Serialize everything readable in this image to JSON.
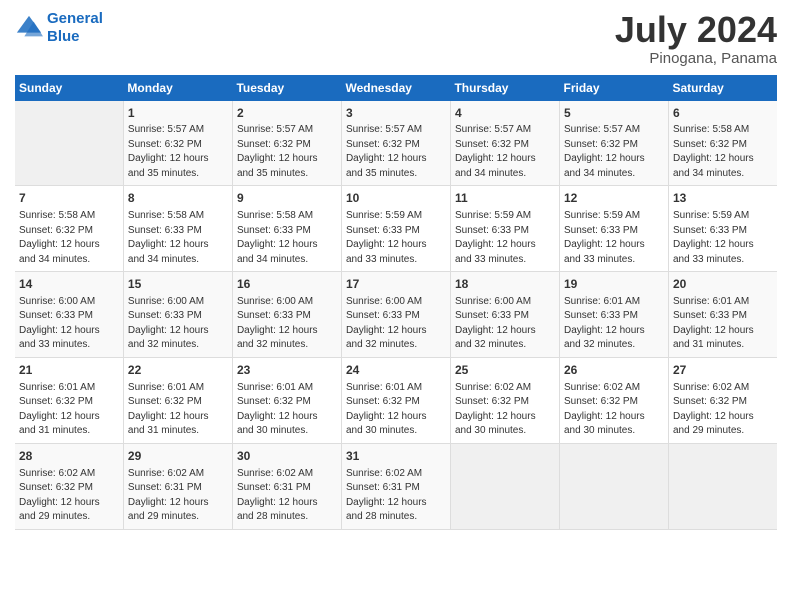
{
  "header": {
    "logo_line1": "General",
    "logo_line2": "Blue",
    "title": "July 2024",
    "subtitle": "Pinogana, Panama"
  },
  "days_of_week": [
    "Sunday",
    "Monday",
    "Tuesday",
    "Wednesday",
    "Thursday",
    "Friday",
    "Saturday"
  ],
  "weeks": [
    [
      {
        "day": "",
        "content": ""
      },
      {
        "day": "1",
        "content": "Sunrise: 5:57 AM\nSunset: 6:32 PM\nDaylight: 12 hours\nand 35 minutes."
      },
      {
        "day": "2",
        "content": "Sunrise: 5:57 AM\nSunset: 6:32 PM\nDaylight: 12 hours\nand 35 minutes."
      },
      {
        "day": "3",
        "content": "Sunrise: 5:57 AM\nSunset: 6:32 PM\nDaylight: 12 hours\nand 35 minutes."
      },
      {
        "day": "4",
        "content": "Sunrise: 5:57 AM\nSunset: 6:32 PM\nDaylight: 12 hours\nand 34 minutes."
      },
      {
        "day": "5",
        "content": "Sunrise: 5:57 AM\nSunset: 6:32 PM\nDaylight: 12 hours\nand 34 minutes."
      },
      {
        "day": "6",
        "content": "Sunrise: 5:58 AM\nSunset: 6:32 PM\nDaylight: 12 hours\nand 34 minutes."
      }
    ],
    [
      {
        "day": "7",
        "content": "Sunrise: 5:58 AM\nSunset: 6:32 PM\nDaylight: 12 hours\nand 34 minutes."
      },
      {
        "day": "8",
        "content": "Sunrise: 5:58 AM\nSunset: 6:33 PM\nDaylight: 12 hours\nand 34 minutes."
      },
      {
        "day": "9",
        "content": "Sunrise: 5:58 AM\nSunset: 6:33 PM\nDaylight: 12 hours\nand 34 minutes."
      },
      {
        "day": "10",
        "content": "Sunrise: 5:59 AM\nSunset: 6:33 PM\nDaylight: 12 hours\nand 33 minutes."
      },
      {
        "day": "11",
        "content": "Sunrise: 5:59 AM\nSunset: 6:33 PM\nDaylight: 12 hours\nand 33 minutes."
      },
      {
        "day": "12",
        "content": "Sunrise: 5:59 AM\nSunset: 6:33 PM\nDaylight: 12 hours\nand 33 minutes."
      },
      {
        "day": "13",
        "content": "Sunrise: 5:59 AM\nSunset: 6:33 PM\nDaylight: 12 hours\nand 33 minutes."
      }
    ],
    [
      {
        "day": "14",
        "content": "Sunrise: 6:00 AM\nSunset: 6:33 PM\nDaylight: 12 hours\nand 33 minutes."
      },
      {
        "day": "15",
        "content": "Sunrise: 6:00 AM\nSunset: 6:33 PM\nDaylight: 12 hours\nand 32 minutes."
      },
      {
        "day": "16",
        "content": "Sunrise: 6:00 AM\nSunset: 6:33 PM\nDaylight: 12 hours\nand 32 minutes."
      },
      {
        "day": "17",
        "content": "Sunrise: 6:00 AM\nSunset: 6:33 PM\nDaylight: 12 hours\nand 32 minutes."
      },
      {
        "day": "18",
        "content": "Sunrise: 6:00 AM\nSunset: 6:33 PM\nDaylight: 12 hours\nand 32 minutes."
      },
      {
        "day": "19",
        "content": "Sunrise: 6:01 AM\nSunset: 6:33 PM\nDaylight: 12 hours\nand 32 minutes."
      },
      {
        "day": "20",
        "content": "Sunrise: 6:01 AM\nSunset: 6:33 PM\nDaylight: 12 hours\nand 31 minutes."
      }
    ],
    [
      {
        "day": "21",
        "content": "Sunrise: 6:01 AM\nSunset: 6:32 PM\nDaylight: 12 hours\nand 31 minutes."
      },
      {
        "day": "22",
        "content": "Sunrise: 6:01 AM\nSunset: 6:32 PM\nDaylight: 12 hours\nand 31 minutes."
      },
      {
        "day": "23",
        "content": "Sunrise: 6:01 AM\nSunset: 6:32 PM\nDaylight: 12 hours\nand 30 minutes."
      },
      {
        "day": "24",
        "content": "Sunrise: 6:01 AM\nSunset: 6:32 PM\nDaylight: 12 hours\nand 30 minutes."
      },
      {
        "day": "25",
        "content": "Sunrise: 6:02 AM\nSunset: 6:32 PM\nDaylight: 12 hours\nand 30 minutes."
      },
      {
        "day": "26",
        "content": "Sunrise: 6:02 AM\nSunset: 6:32 PM\nDaylight: 12 hours\nand 30 minutes."
      },
      {
        "day": "27",
        "content": "Sunrise: 6:02 AM\nSunset: 6:32 PM\nDaylight: 12 hours\nand 29 minutes."
      }
    ],
    [
      {
        "day": "28",
        "content": "Sunrise: 6:02 AM\nSunset: 6:32 PM\nDaylight: 12 hours\nand 29 minutes."
      },
      {
        "day": "29",
        "content": "Sunrise: 6:02 AM\nSunset: 6:31 PM\nDaylight: 12 hours\nand 29 minutes."
      },
      {
        "day": "30",
        "content": "Sunrise: 6:02 AM\nSunset: 6:31 PM\nDaylight: 12 hours\nand 28 minutes."
      },
      {
        "day": "31",
        "content": "Sunrise: 6:02 AM\nSunset: 6:31 PM\nDaylight: 12 hours\nand 28 minutes."
      },
      {
        "day": "",
        "content": ""
      },
      {
        "day": "",
        "content": ""
      },
      {
        "day": "",
        "content": ""
      }
    ]
  ]
}
